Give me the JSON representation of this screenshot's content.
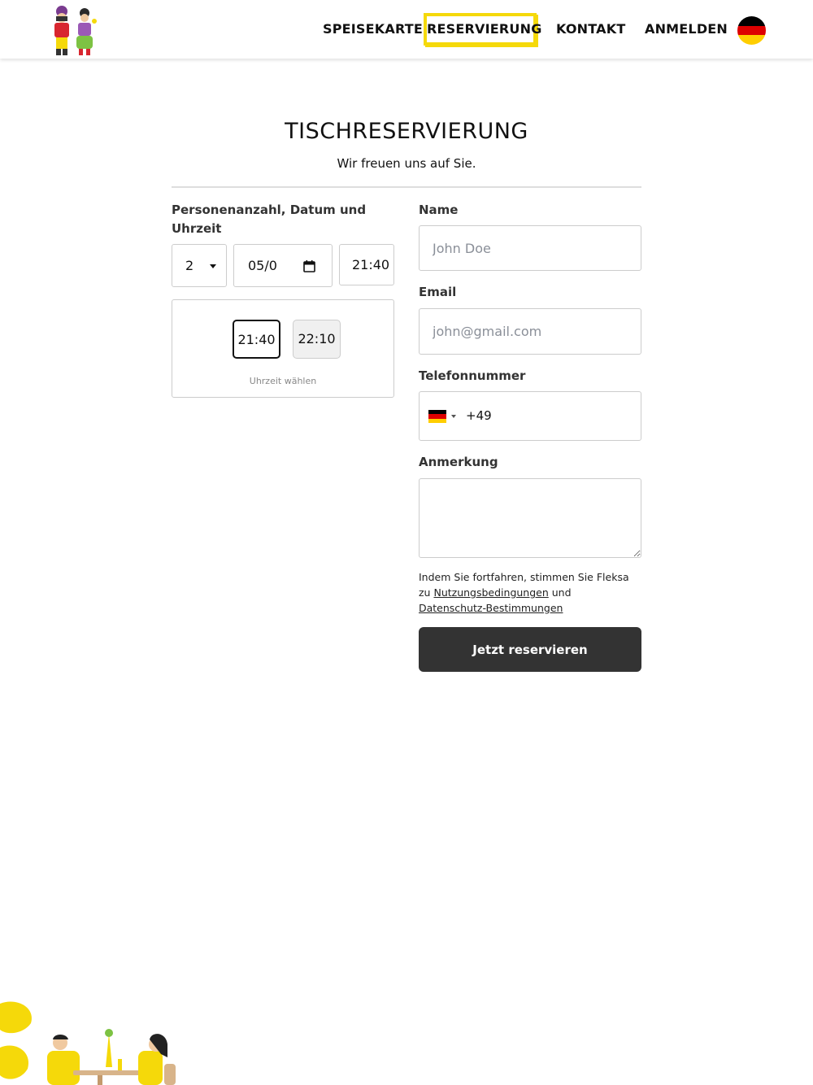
{
  "header": {
    "nav": [
      {
        "label": "SPEISEKARTE"
      },
      {
        "label": "RESERVIERUNG"
      },
      {
        "label": "KONTAKT"
      },
      {
        "label": "ANMELDEN"
      }
    ]
  },
  "page": {
    "title": "TISCHRESERVIERUNG",
    "subtitle": "Wir freuen uns auf Sie."
  },
  "booking": {
    "label": "Personenanzahl, Datum und Uhrzeit",
    "persons": "2",
    "date": "05/0",
    "time": "21:40",
    "slots": [
      "21:40",
      "22:10"
    ],
    "slot_hint": "Uhrzeit wählen"
  },
  "form": {
    "name_label": "Name",
    "name_placeholder": "John Doe",
    "email_label": "Email",
    "email_placeholder": "john@gmail.com",
    "phone_label": "Telefonnummer",
    "phone_code": "+49",
    "note_label": "Anmerkung",
    "legal_prefix": "Indem Sie fortfahren, stimmen Sie Fleksa zu ",
    "terms_link": "Nutzungsbedingungen",
    "legal_and": " und ",
    "privacy_link": "Datenschutz-Bestimmungen",
    "submit_label": "Jetzt reservieren"
  },
  "colors": {
    "accent": "#f5d90a",
    "button": "#333333"
  },
  "icons": [
    "germany-flag-icon",
    "calendar-icon",
    "chevron-down-icon"
  ]
}
